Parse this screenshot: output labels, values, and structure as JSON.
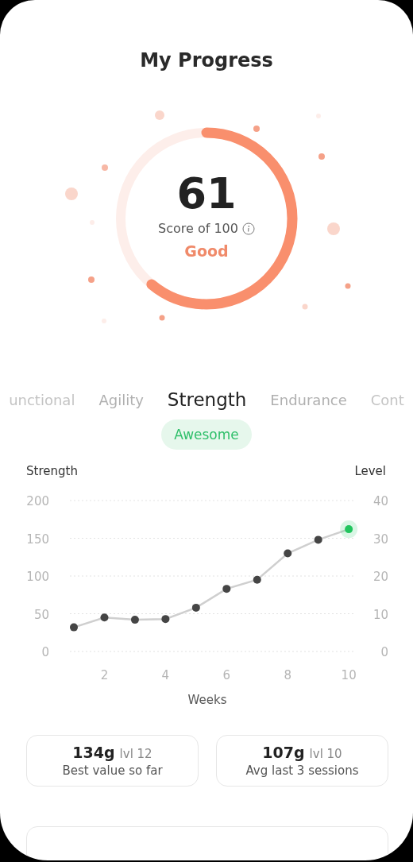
{
  "title": "My Progress",
  "score": {
    "value": "61",
    "caption": "Score of 100",
    "rating": "Good",
    "level": 0.61
  },
  "tabs": [
    {
      "label": "unctional",
      "selected": false
    },
    {
      "label": "Agility",
      "selected": false
    },
    {
      "label": "Strength",
      "selected": true
    },
    {
      "label": "Endurance",
      "selected": false
    },
    {
      "label": "Cont",
      "selected": false
    }
  ],
  "badge": "Awesome",
  "chart": {
    "chart_data": {
      "type": "line",
      "xlabel": "Weeks",
      "ylabel": "Strength",
      "x": [
        1,
        2,
        3,
        4,
        5,
        6,
        7,
        8,
        9,
        10
      ],
      "series": [
        {
          "color": "#454545",
          "marker": "circle",
          "values": [
            32,
            45,
            42,
            43,
            58,
            83,
            95,
            130,
            148,
            162
          ]
        }
      ],
      "xlim": [
        0.87,
        10.23
      ],
      "ylim": [
        0,
        200
      ],
      "xticks": [
        2,
        4,
        6,
        8,
        10
      ],
      "yticks": [
        0,
        50,
        100,
        150,
        200
      ],
      "grid": true,
      "y2label": "Level",
      "y2lim": [
        0,
        40
      ],
      "y2ticks": [
        0,
        10,
        20,
        30,
        40
      ]
    }
  },
  "stats": [
    {
      "value": "134g",
      "level": "lvl 12",
      "caption": "Best value so far"
    },
    {
      "value": "107g",
      "level": "lvl 10",
      "caption": "Avg last 3 sessions"
    }
  ]
}
